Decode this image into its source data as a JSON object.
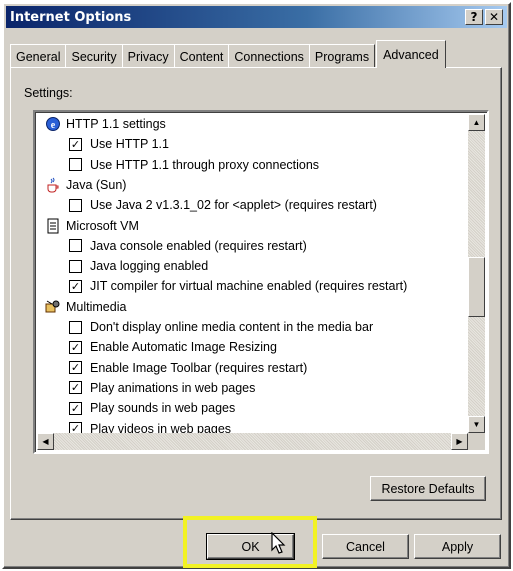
{
  "window": {
    "title": "Internet Options",
    "help_label": "?",
    "close_label": "✕"
  },
  "tabs": [
    {
      "label": "General"
    },
    {
      "label": "Security"
    },
    {
      "label": "Privacy"
    },
    {
      "label": "Content"
    },
    {
      "label": "Connections"
    },
    {
      "label": "Programs"
    },
    {
      "label": "Advanced",
      "active": true
    }
  ],
  "settings_label": "Settings:",
  "settings": [
    {
      "kind": "category",
      "icon": "ie-globe-icon",
      "label": "HTTP 1.1 settings"
    },
    {
      "kind": "option",
      "checked": true,
      "label": "Use HTTP 1.1"
    },
    {
      "kind": "option",
      "checked": false,
      "label": "Use HTTP 1.1 through proxy connections"
    },
    {
      "kind": "category",
      "icon": "java-cup-icon",
      "label": "Java (Sun)"
    },
    {
      "kind": "option",
      "checked": false,
      "label": "Use Java 2 v1.3.1_02 for <applet> (requires restart)"
    },
    {
      "kind": "category",
      "icon": "document-icon",
      "label": "Microsoft VM"
    },
    {
      "kind": "option",
      "checked": false,
      "label": "Java console enabled (requires restart)"
    },
    {
      "kind": "option",
      "checked": false,
      "label": "Java logging enabled"
    },
    {
      "kind": "option",
      "checked": true,
      "label": "JIT compiler for virtual machine enabled (requires restart)"
    },
    {
      "kind": "category",
      "icon": "multimedia-icon",
      "label": "Multimedia"
    },
    {
      "kind": "option",
      "checked": false,
      "label": "Don't display online media content in the media bar"
    },
    {
      "kind": "option",
      "checked": true,
      "label": "Enable Automatic Image Resizing"
    },
    {
      "kind": "option",
      "checked": true,
      "label": "Enable Image Toolbar (requires restart)"
    },
    {
      "kind": "option",
      "checked": true,
      "label": "Play animations in web pages"
    },
    {
      "kind": "option",
      "checked": true,
      "label": "Play sounds in web pages"
    },
    {
      "kind": "option",
      "checked": true,
      "label": "Play videos in web pages"
    }
  ],
  "buttons": {
    "restore_defaults": "Restore Defaults",
    "ok": "OK",
    "cancel": "Cancel",
    "apply": "Apply"
  },
  "colors": {
    "titlebar": "#0a246a",
    "face": "#d4d0c8",
    "highlight": "#f2f224"
  },
  "scroll": {
    "vertical_position": 0.55
  }
}
